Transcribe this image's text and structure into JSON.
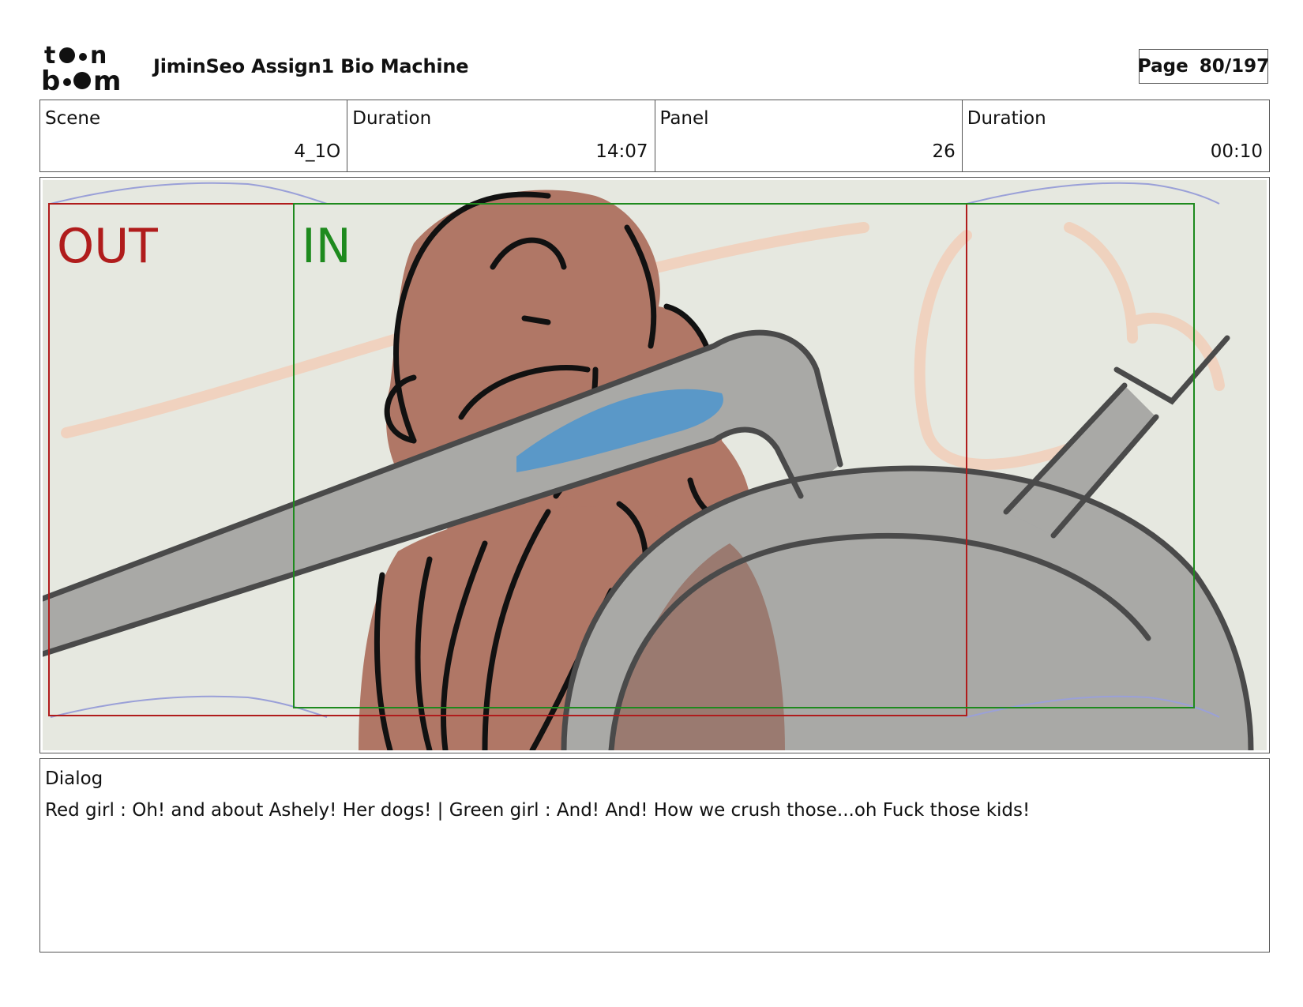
{
  "header": {
    "logo_alt": "toon boom",
    "project_title": "JiminSeo Assign1 Bio Machine",
    "page_label": "Page",
    "page_number": "80/197"
  },
  "info": {
    "scene_label": "Scene",
    "scene_value": "4_1O",
    "scene_duration_label": "Duration",
    "scene_duration_value": "14:07",
    "panel_label": "Panel",
    "panel_value": "26",
    "panel_duration_label": "Duration",
    "panel_duration_value": "00:10"
  },
  "panel": {
    "out_label": "OUT",
    "in_label": "IN",
    "colors": {
      "out_frame": "#b01c1c",
      "in_frame": "#1e8a1e",
      "skin": "#b07766",
      "metal": "#a9a9a6",
      "blue_tube": "#5a98c8",
      "background": "#e6e8e0"
    }
  },
  "dialog": {
    "label": "Dialog",
    "text": "Red girl : Oh! and about Ashely! Her dogs! | Green girl : And! And! How we crush those...oh Fuck those kids!"
  }
}
